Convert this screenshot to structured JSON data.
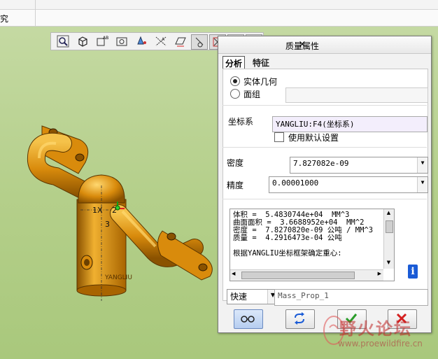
{
  "topbar": {
    "text": "究"
  },
  "toolbar": {
    "icons": [
      "zoom-fit-icon",
      "view-cube-icon",
      "saved-views-icon",
      "camera-icon",
      "spin-center-icon",
      "datum-axes-icon",
      "datum-plane-icon",
      "annotation-icon",
      "point-display-icon",
      "coordinate-display-icon",
      "csys-display-icon"
    ]
  },
  "model": {
    "label_1x": "1X",
    "label_2": "2",
    "label_3": "3",
    "label_yangliu": "YANGLIU",
    "colors": {
      "body": "#d98b0c",
      "highlight": "#f5c24a",
      "shadow": "#8a5200"
    }
  },
  "dialog": {
    "title": "质量属性",
    "close": "×",
    "tabs": [
      {
        "label": "分析"
      },
      {
        "label": "特征"
      }
    ],
    "geometry": {
      "solid_label": "实体几何",
      "facet_label": "面组"
    },
    "csys": {
      "label": "坐标系",
      "value": "YANGLIU:F4(坐标系)",
      "default_label": "使用默认设置"
    },
    "density": {
      "label": "密度",
      "value": "7.827082e-09"
    },
    "accuracy": {
      "label": "精度",
      "value": "0.00001000"
    },
    "results": {
      "lines": [
        "体积 =  5.4830744e+04  MM^3",
        "曲面面积 =  3.6688952e+04  MM^2",
        "密度 =  7.8270820e-09 公吨 / MM^3",
        "质量 =  4.2916473e-04 公吨",
        "",
        "根据YANGLIU坐标框架确定重心:"
      ]
    },
    "mode": {
      "value": "快速"
    },
    "name": {
      "value": "Mass_Prop_1"
    },
    "buttons": {
      "preview_icon": "glasses-icon",
      "repeat_icon": "repeat-icon",
      "ok_icon": "check-icon",
      "cancel_icon": "cancel-x-icon"
    },
    "colors": {
      "ok": "#2a9d2a",
      "cancel": "#d42020",
      "info": "#1a5bd6"
    }
  },
  "watermark": {
    "brand": "野火论坛",
    "url": "www.proewildfire.cn"
  }
}
